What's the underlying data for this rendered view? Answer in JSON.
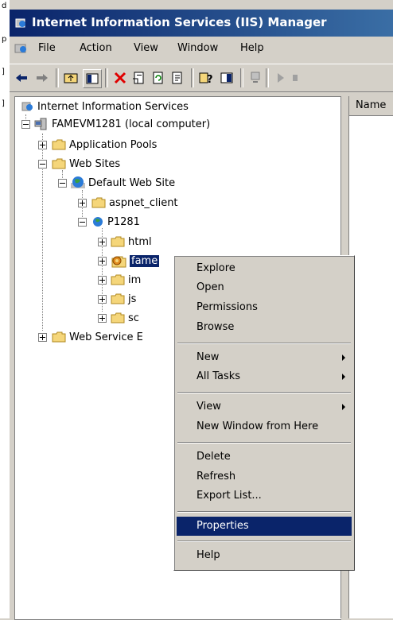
{
  "window": {
    "title": "Internet Information Services (IIS) Manager"
  },
  "menubar": {
    "items": [
      "File",
      "Action",
      "View",
      "Window",
      "Help"
    ]
  },
  "toolbar": {
    "icons": [
      "back-arrow-icon",
      "forward-arrow-icon",
      "up-folder-icon",
      "show-hide-tree-icon",
      "delete-icon",
      "properties-icon",
      "refresh-icon",
      "export-list-icon",
      "help-icon",
      "console-icon",
      "computer-icon",
      "play-icon",
      "stop-icon"
    ]
  },
  "tree": {
    "root": "Internet Information Services",
    "computer": "FAMEVM1281 (local computer)",
    "app_pools": "Application Pools",
    "web_sites": "Web Sites",
    "default_site": "Default Web Site",
    "aspnet_client": "aspnet_client",
    "p1281": "P1281",
    "html": "html",
    "fame": "fame",
    "im": "im",
    "js": "js",
    "sc": "sc",
    "wse": "Web Service E"
  },
  "list": {
    "column_name": "Name"
  },
  "context_menu": {
    "explore": "Explore",
    "open": "Open",
    "permissions": "Permissions",
    "browse": "Browse",
    "new": "New",
    "all_tasks": "All Tasks",
    "view": "View",
    "new_window": "New Window from Here",
    "delete": "Delete",
    "refresh": "Refresh",
    "export_list": "Export List...",
    "properties": "Properties",
    "help": "Help"
  },
  "colors": {
    "titlebar": "#0a246a",
    "highlight": "#0a246a",
    "face": "#d4d0c8"
  }
}
